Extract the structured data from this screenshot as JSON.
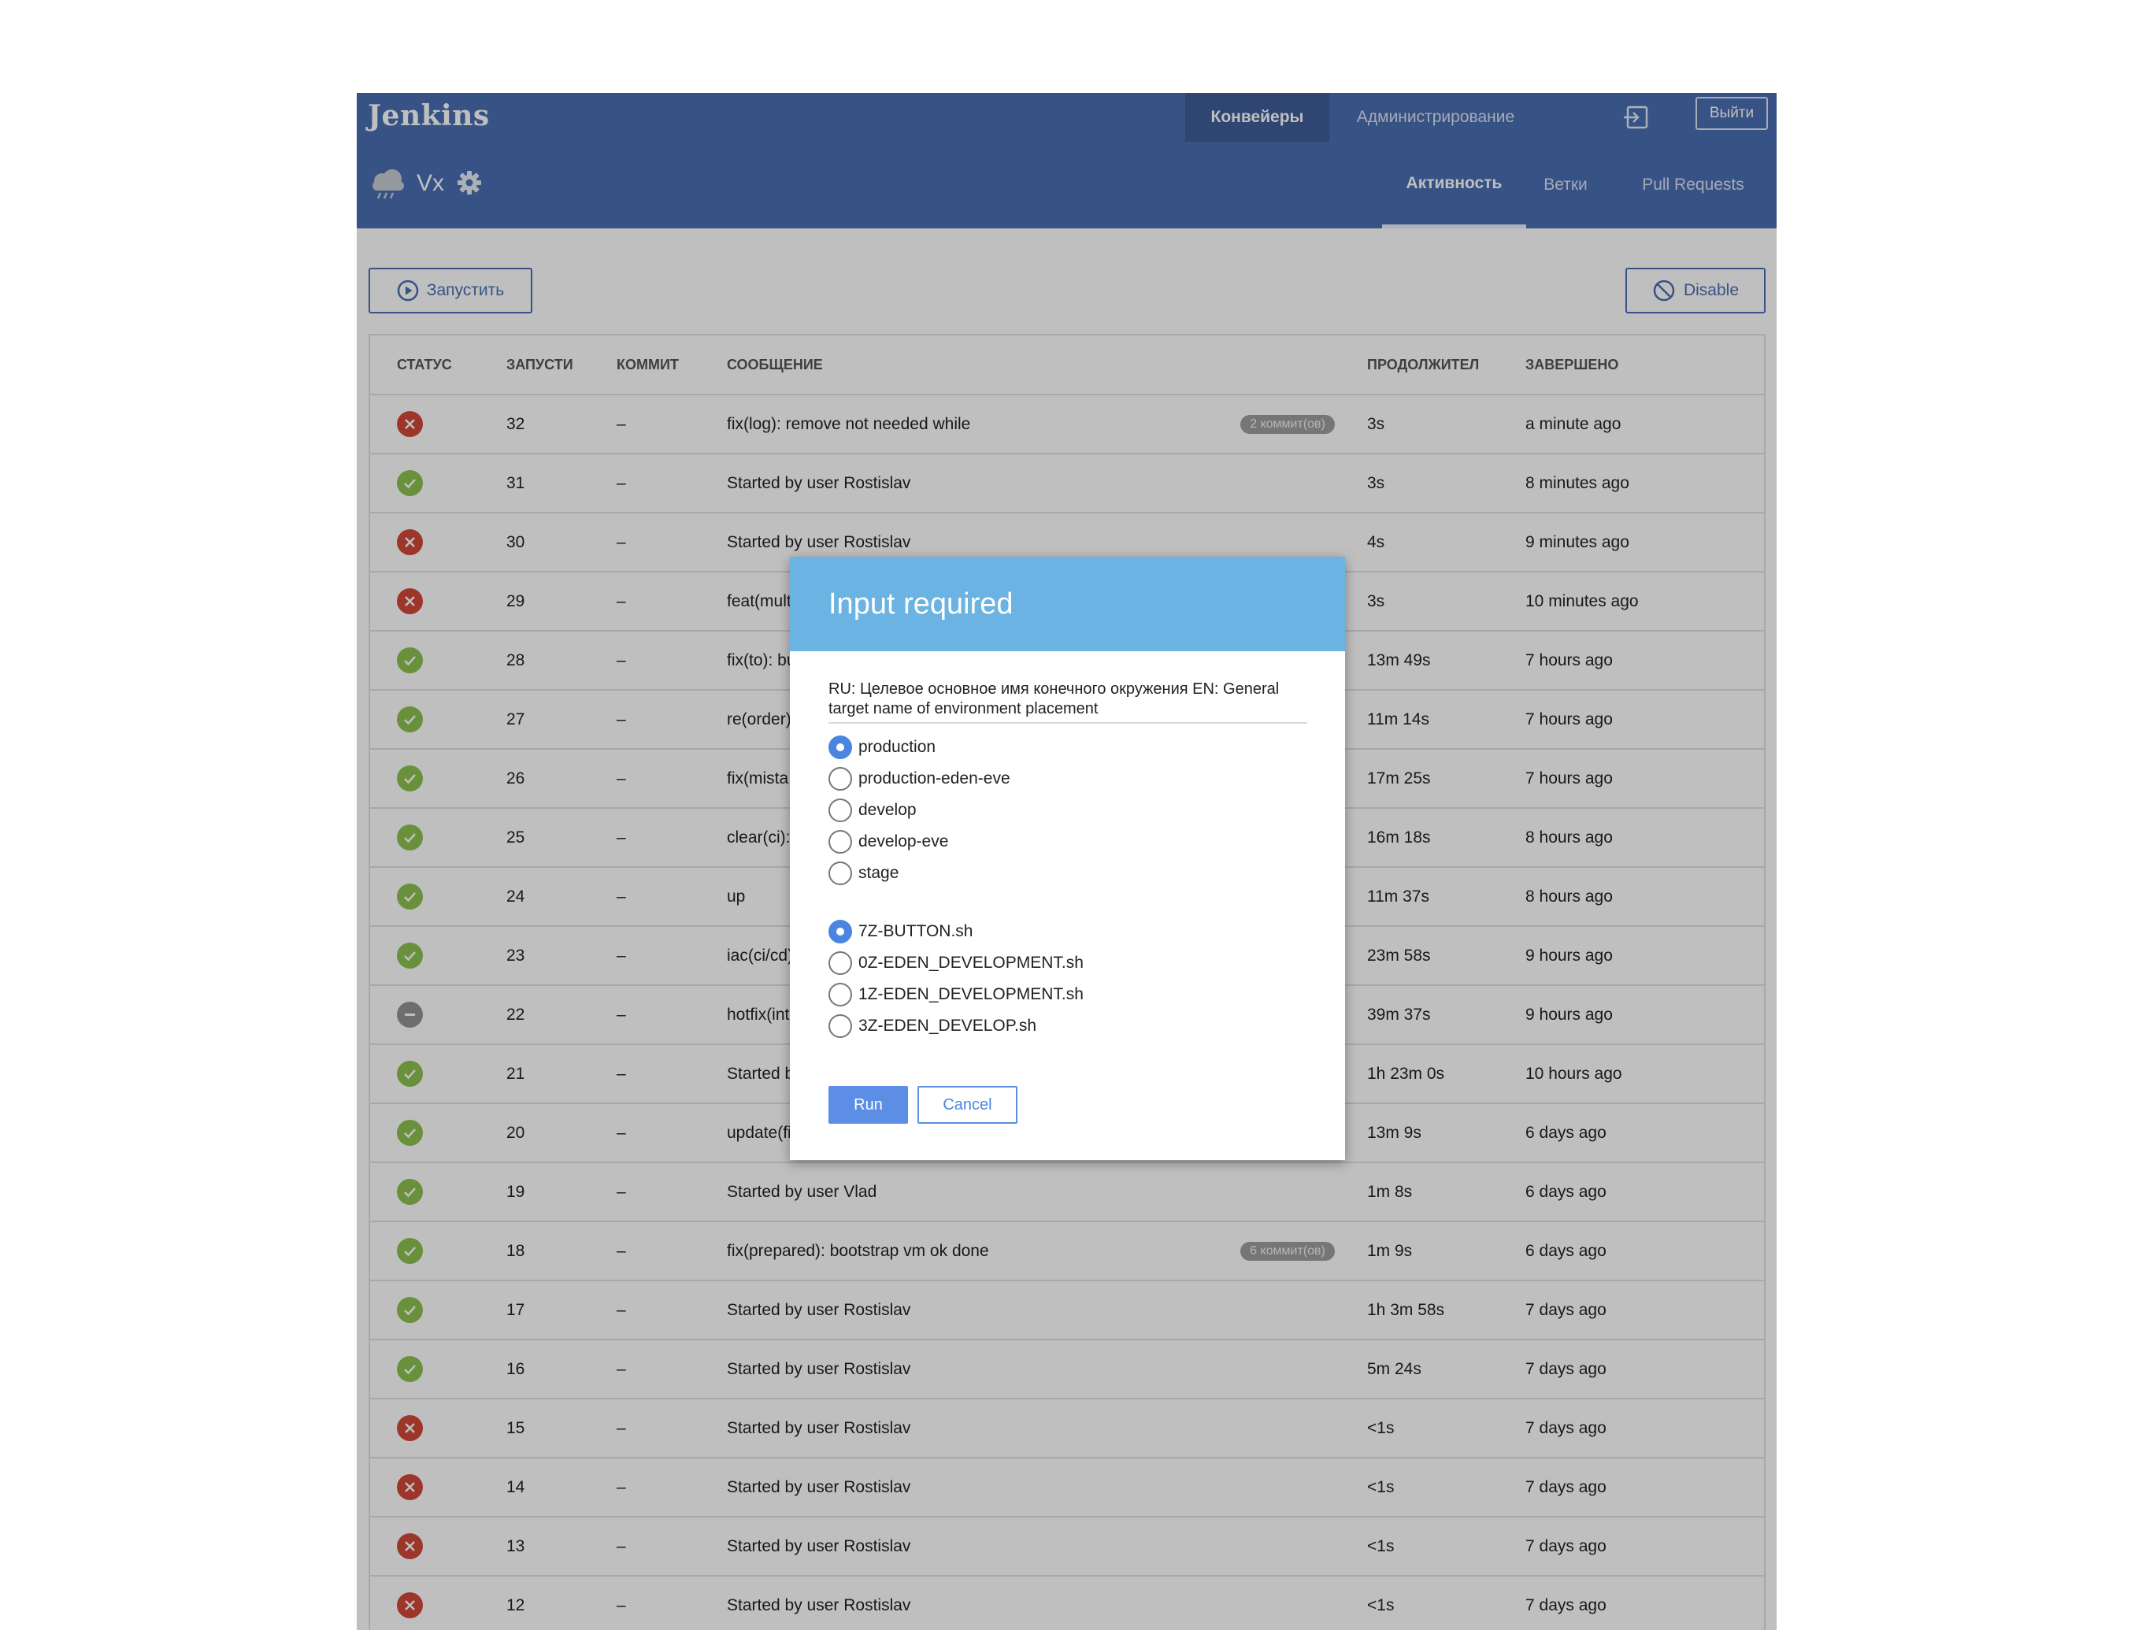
{
  "header": {
    "logo": "Jenkins",
    "nav_pipelines": "Конвейеры",
    "nav_admin": "Администрирование",
    "logout": "Выйти"
  },
  "pipeline": {
    "name": "Vx",
    "tabs": {
      "activity": "Активность",
      "branches": "Ветки",
      "pull_requests": "Pull Requests"
    }
  },
  "toolbar": {
    "run_label": "Запустить",
    "disable_label": "Disable"
  },
  "table": {
    "columns": {
      "status": "СТАТУС",
      "run": "ЗАПУСТИ",
      "commit": "КОММИТ",
      "message": "СООБЩЕНИЕ",
      "duration": "ПРОДОЛЖИТЕЛ",
      "completed": "ЗАВЕРШЕНО"
    },
    "rows": [
      {
        "status": "failure",
        "run": "32",
        "commit": "–",
        "message": "fix(log): remove not needed while",
        "badge": "2 коммит(ов)",
        "duration": "3s",
        "completed": "a minute ago"
      },
      {
        "status": "success",
        "run": "31",
        "commit": "–",
        "message": "Started by user Rostislav",
        "badge": "",
        "duration": "3s",
        "completed": "8 minutes ago"
      },
      {
        "status": "failure",
        "run": "30",
        "commit": "–",
        "message": "Started by user Rostislav",
        "badge": "",
        "duration": "4s",
        "completed": "9 minutes ago"
      },
      {
        "status": "failure",
        "run": "29",
        "commit": "–",
        "message": "feat(mult",
        "badge": "",
        "duration": "3s",
        "completed": "10 minutes ago"
      },
      {
        "status": "success",
        "run": "28",
        "commit": "–",
        "message": "fix(to): bu",
        "badge": "",
        "duration": "13m 49s",
        "completed": "7 hours ago"
      },
      {
        "status": "success",
        "run": "27",
        "commit": "–",
        "message": "re(order)",
        "badge": "",
        "duration": "11m 14s",
        "completed": "7 hours ago"
      },
      {
        "status": "success",
        "run": "26",
        "commit": "–",
        "message": "fix(mista",
        "badge": "",
        "duration": "17m 25s",
        "completed": "7 hours ago"
      },
      {
        "status": "success",
        "run": "25",
        "commit": "–",
        "message": "clear(ci):",
        "badge": "",
        "duration": "16m 18s",
        "completed": "8 hours ago"
      },
      {
        "status": "success",
        "run": "24",
        "commit": "–",
        "message": "up",
        "badge": "",
        "duration": "11m 37s",
        "completed": "8 hours ago"
      },
      {
        "status": "success",
        "run": "23",
        "commit": "–",
        "message": "iac(ci/cd)",
        "badge": "",
        "duration": "23m 58s",
        "completed": "9 hours ago"
      },
      {
        "status": "aborted",
        "run": "22",
        "commit": "–",
        "message": "hotfix(int",
        "badge": "",
        "duration": "39m 37s",
        "completed": "9 hours ago"
      },
      {
        "status": "success",
        "run": "21",
        "commit": "–",
        "message": "Started b",
        "badge": "",
        "duration": "1h 23m 0s",
        "completed": "10 hours ago"
      },
      {
        "status": "success",
        "run": "20",
        "commit": "–",
        "message": "update(fi",
        "badge": "",
        "duration": "13m 9s",
        "completed": "6 days ago"
      },
      {
        "status": "success",
        "run": "19",
        "commit": "–",
        "message": "Started by user Vlad",
        "badge": "",
        "duration": "1m 8s",
        "completed": "6 days ago"
      },
      {
        "status": "success",
        "run": "18",
        "commit": "–",
        "message": "fix(prepared): bootstrap vm ok done",
        "badge": "6 коммит(ов)",
        "duration": "1m 9s",
        "completed": "6 days ago"
      },
      {
        "status": "success",
        "run": "17",
        "commit": "–",
        "message": "Started by user Rostislav",
        "badge": "",
        "duration": "1h 3m 58s",
        "completed": "7 days ago"
      },
      {
        "status": "success",
        "run": "16",
        "commit": "–",
        "message": "Started by user Rostislav",
        "badge": "",
        "duration": "5m 24s",
        "completed": "7 days ago"
      },
      {
        "status": "failure",
        "run": "15",
        "commit": "–",
        "message": "Started by user Rostislav",
        "badge": "",
        "duration": "<1s",
        "completed": "7 days ago"
      },
      {
        "status": "failure",
        "run": "14",
        "commit": "–",
        "message": "Started by user Rostislav",
        "badge": "",
        "duration": "<1s",
        "completed": "7 days ago"
      },
      {
        "status": "failure",
        "run": "13",
        "commit": "–",
        "message": "Started by user Rostislav",
        "badge": "",
        "duration": "<1s",
        "completed": "7 days ago"
      },
      {
        "status": "failure",
        "run": "12",
        "commit": "–",
        "message": "Started by user Rostislav",
        "badge": "",
        "duration": "<1s",
        "completed": "7 days ago"
      }
    ]
  },
  "modal": {
    "title": "Input required",
    "description": "RU: Целевое основное имя конечного окружения EN: General target name of environment placement",
    "group1": [
      {
        "label": "production",
        "checked": true
      },
      {
        "label": "production-eden-eve",
        "checked": false
      },
      {
        "label": "develop",
        "checked": false
      },
      {
        "label": "develop-eve",
        "checked": false
      },
      {
        "label": "stage",
        "checked": false
      }
    ],
    "group2": [
      {
        "label": "7Z-BUTTON.sh",
        "checked": true
      },
      {
        "label": "0Z-EDEN_DEVELOPMENT.sh",
        "checked": false
      },
      {
        "label": "1Z-EDEN_DEVELOPMENT.sh",
        "checked": false
      },
      {
        "label": "3Z-EDEN_DEVELOP.sh",
        "checked": false
      }
    ],
    "run_label": "Run",
    "cancel_label": "Cancel"
  },
  "colors": {
    "header_bg": "#4a6eb0",
    "success": "#8cc04f",
    "failure": "#d24939",
    "aborted": "#949393",
    "modal_header": "#6ab3e2",
    "primary_button": "#5c8ee6"
  },
  "icons": {
    "weather": "cloud-rain-icon",
    "settings": "gear-icon",
    "login": "login-icon",
    "run": "play-circle-icon",
    "disable": "ban-icon"
  }
}
